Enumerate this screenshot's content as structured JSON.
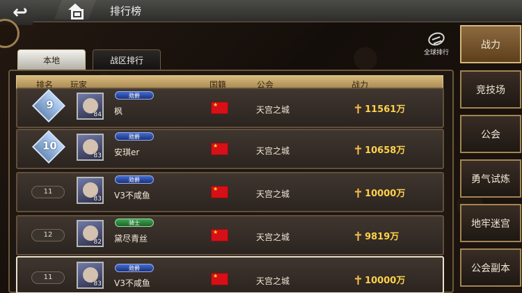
{
  "header": {
    "title": "排行榜",
    "global_rank_label": "全球排行"
  },
  "tabs": [
    {
      "label": "本地"
    },
    {
      "label": "战区排行"
    }
  ],
  "table": {
    "columns": [
      "排名",
      "玩家",
      "国籍",
      "公会",
      "战力"
    ],
    "rows": [
      {
        "rank": "9",
        "badge": "勋爵",
        "name": "枫",
        "guild": "天宫之城",
        "power": "11561万",
        "level": "84"
      },
      {
        "rank": "10",
        "badge": "勋爵",
        "name": "安琪er",
        "guild": "天宫之城",
        "power": "10658万",
        "level": "83"
      },
      {
        "rank": "11",
        "badge": "勋爵",
        "name": "V3不咸鱼",
        "guild": "天宫之城",
        "power": "10000万",
        "level": "83"
      },
      {
        "rank": "12",
        "badge": "骑士",
        "name": "黛尽青丝",
        "guild": "天宫之城",
        "power": "9819万",
        "level": "82"
      },
      {
        "rank": "11",
        "badge": "勋爵",
        "name": "V3不咸鱼",
        "guild": "天宫之城",
        "power": "10000万",
        "level": "83"
      }
    ]
  },
  "sidebar": [
    {
      "label": "战力"
    },
    {
      "label": "竞技场"
    },
    {
      "label": "公会"
    },
    {
      "label": "勇气试炼"
    },
    {
      "label": "地牢迷宫"
    },
    {
      "label": "公会副本"
    }
  ],
  "colors": {
    "accent_gold": "#d8bb7c",
    "power_text": "#ffd24a",
    "flag_red": "#d70f16"
  }
}
